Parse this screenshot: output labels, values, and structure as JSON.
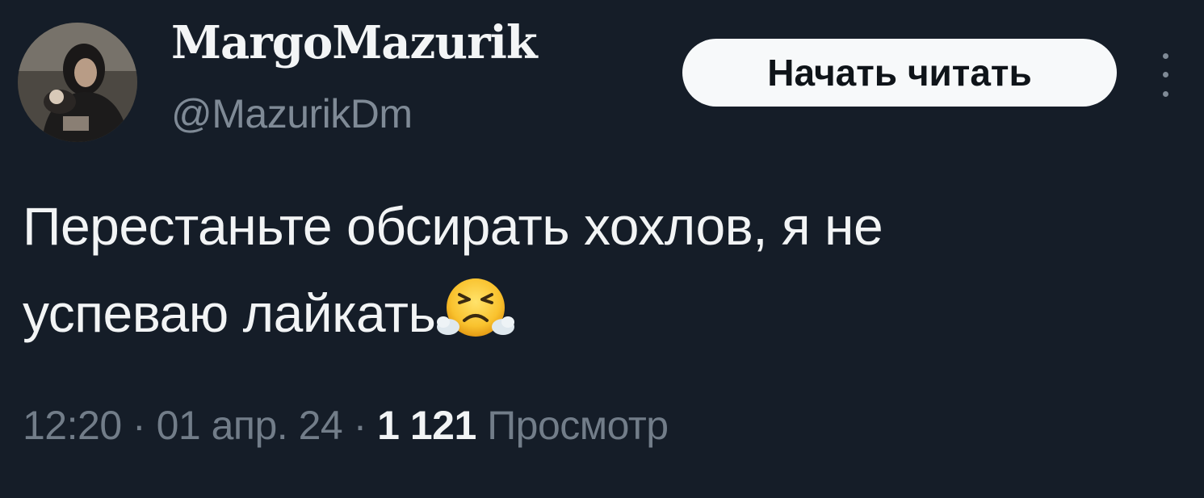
{
  "author": {
    "display_name": "MargoMazurik",
    "handle": "@MazurikDm"
  },
  "follow_button": {
    "label": "Начать читать"
  },
  "more_menu": {
    "icon": "more-vertical-icon"
  },
  "tweet": {
    "line1": "Перестаньте обсирать хохлов, я не",
    "line2": "успеваю лайкать",
    "emoji": "😤"
  },
  "meta": {
    "time": "12:20",
    "separator": "·",
    "date": "01 апр. 24",
    "views_count": "1 121",
    "views_label": "Просмотр"
  },
  "colors": {
    "background": "#151d28",
    "primary_text": "#f2f4f5",
    "secondary_text": "#7f8a96",
    "button_bg": "#f7f9fa"
  }
}
